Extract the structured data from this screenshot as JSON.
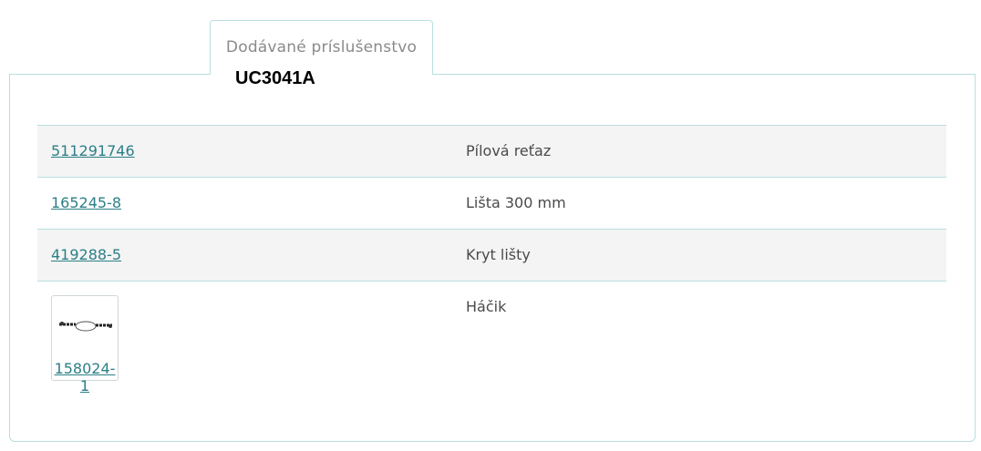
{
  "tab": {
    "label": "Dodávané príslušenstvo"
  },
  "model": "UC3041A",
  "accessories": [
    {
      "code": "511291746",
      "description": "Pílová reťaz"
    },
    {
      "code": "165245-8",
      "description": "Lišta 300 mm"
    },
    {
      "code": "419288-5",
      "description": "Kryt lišty"
    },
    {
      "code": "158024-1",
      "description": "Háčik",
      "image": "hook-chain-image"
    }
  ],
  "colors": {
    "accent": "#2b7f86",
    "border": "#b9dde1",
    "row_shade": "#f4f4f4"
  }
}
